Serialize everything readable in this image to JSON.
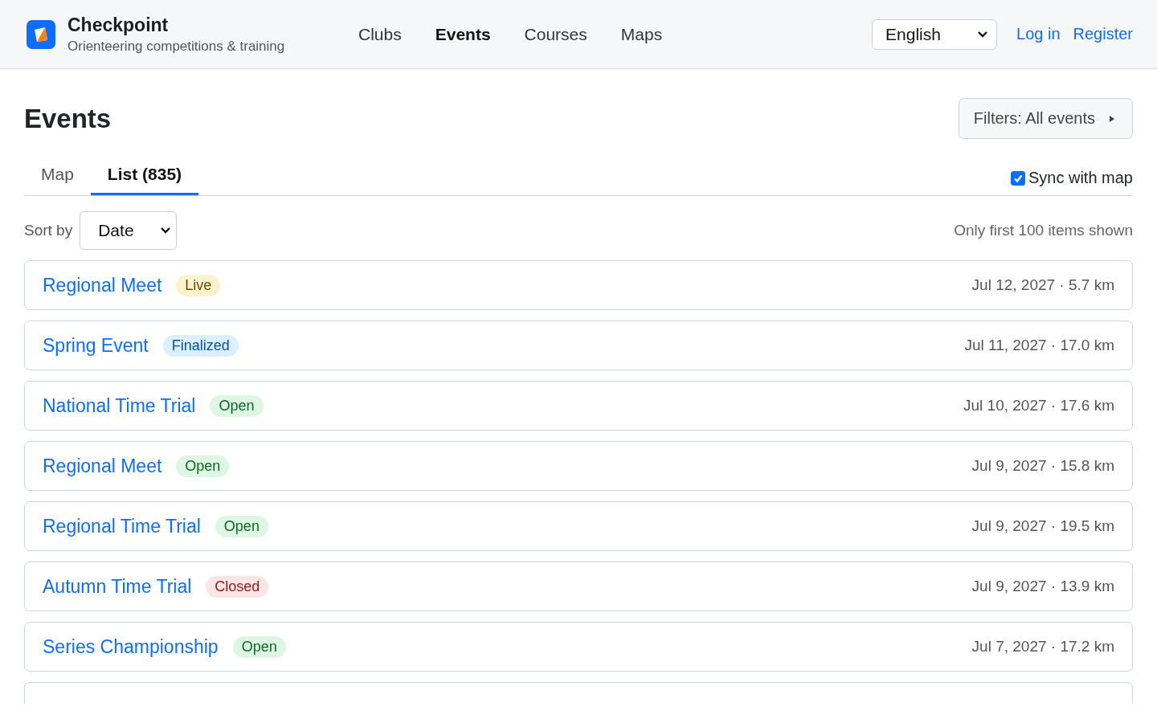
{
  "brand": {
    "name": "Checkpoint",
    "tagline": "Orienteering competitions & training"
  },
  "nav": [
    {
      "label": "Clubs",
      "selected": false
    },
    {
      "label": "Events",
      "selected": true
    },
    {
      "label": "Courses",
      "selected": false
    },
    {
      "label": "Maps",
      "selected": false
    }
  ],
  "language": {
    "value": "English"
  },
  "auth_links": [
    "Log in",
    "Register"
  ],
  "page_title": "Events",
  "filters_button": "Filters: All events",
  "tabs": [
    {
      "label": "Map",
      "selected": false
    },
    {
      "label": "List (835)",
      "selected": true
    }
  ],
  "sync": {
    "label": "Sync with map",
    "checked": true
  },
  "sort": {
    "label": "Sort by",
    "value": "Date"
  },
  "note": "Only first 100 items shown",
  "events": [
    {
      "name": "Regional Meet",
      "status": "Live",
      "kind": "live",
      "meta": "Jul 12, 2027 · 5.7 km"
    },
    {
      "name": "Spring Event",
      "status": "Finalized",
      "kind": "finalized",
      "meta": "Jul 11, 2027 · 17.0 km"
    },
    {
      "name": "National Time Trial",
      "status": "Open",
      "kind": "open",
      "meta": "Jul 10, 2027 · 17.6 km"
    },
    {
      "name": "Regional Meet",
      "status": "Open",
      "kind": "open",
      "meta": "Jul 9, 2027 · 15.8 km"
    },
    {
      "name": "Regional Time Trial",
      "status": "Open",
      "kind": "open",
      "meta": "Jul 9, 2027 · 19.5 km"
    },
    {
      "name": "Autumn Time Trial",
      "status": "Closed",
      "kind": "closed",
      "meta": "Jul 9, 2027 · 13.9 km"
    },
    {
      "name": "Series Championship",
      "status": "Open",
      "kind": "open",
      "meta": "Jul 7, 2027 · 17.2 km"
    }
  ]
}
